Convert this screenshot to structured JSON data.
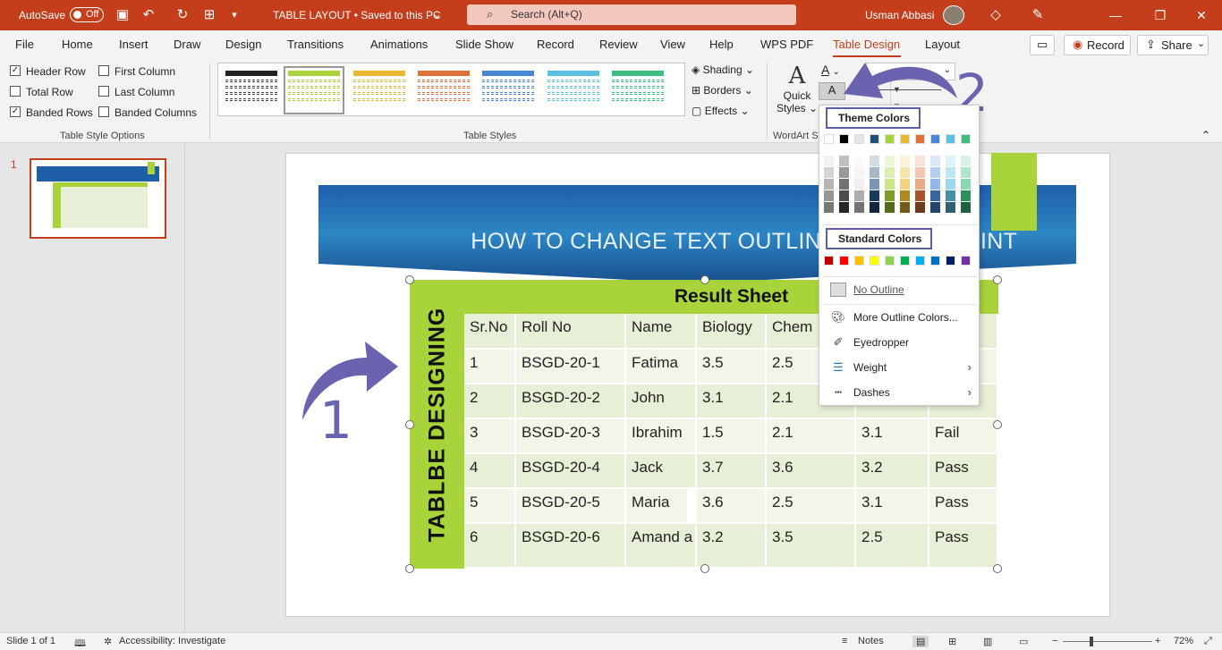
{
  "titlebar": {
    "autosave_label": "AutoSave",
    "autosave_state": "Off",
    "doc_title": "TABLE LAYOUT • Saved to this PC",
    "search_placeholder": "Search (Alt+Q)",
    "user_name": "Usman Abbasi"
  },
  "menu": {
    "tabs": [
      "File",
      "Home",
      "Insert",
      "Draw",
      "Design",
      "Transitions",
      "Animations",
      "Slide Show",
      "Record",
      "Review",
      "View",
      "Help",
      "WPS PDF",
      "Table Design",
      "Layout"
    ],
    "active_tab": "Table Design",
    "record_label": "Record",
    "share_label": "Share"
  },
  "ribbon": {
    "table_style_options": {
      "header_row": "Header Row",
      "first_column": "First Column",
      "total_row": "Total Row",
      "last_column": "Last Column",
      "banded_rows": "Banded Rows",
      "banded_columns": "Banded Columns",
      "group_label": "Table Style Options",
      "checked": {
        "header_row": true,
        "first_column": false,
        "total_row": false,
        "last_column": false,
        "banded_rows": true,
        "banded_columns": false
      }
    },
    "table_styles": {
      "group_label": "Table Styles",
      "shading": "Shading",
      "borders": "Borders",
      "effects": "Effects",
      "thumb_colors": [
        "#222222",
        "#a8d33a",
        "#e8b830",
        "#e0713a",
        "#4a86d6",
        "#5cc0e0",
        "#3cbf7e"
      ]
    },
    "wordart": {
      "quick": "Quick",
      "styles": "Styles",
      "group_label": "WordArt S"
    }
  },
  "slide_panel": {
    "slide_number": "1"
  },
  "slide": {
    "title": "HOW TO CHANGE TEXT OUTLINE COLOR",
    "title_tail": "INT",
    "side_label": "TABLBE DESIGNING",
    "table_title": "Result  Sheet",
    "headers": [
      "Sr.No",
      "Roll No",
      "Name",
      "Biology",
      "Chem",
      "",
      ""
    ],
    "rows": [
      [
        "1",
        "BSGD-20-1",
        "Fatima",
        "3.5",
        "2.5",
        "",
        ""
      ],
      [
        "2",
        "BSGD-20-2",
        "John",
        "3.1",
        "2.1",
        "",
        ""
      ],
      [
        "3",
        "BSGD-20-3",
        "Ibrahim",
        "1.5",
        "2.1",
        "3.1",
        "Fail"
      ],
      [
        "4",
        "BSGD-20-4",
        "Jack",
        "3.7",
        "3.6",
        "3.2",
        "Pass"
      ],
      [
        "5",
        "BSGD-20-5",
        "Maria",
        "3.6",
        "2.5",
        "3.1",
        "Pass"
      ],
      [
        "6",
        "BSGD-20-6",
        "Amand a",
        "3.2",
        "3.5",
        "2.5",
        "Pass"
      ]
    ]
  },
  "dropdown": {
    "theme_colors_title": "Theme Colors",
    "standard_colors_title": "Standard Colors",
    "theme_top_row": [
      "#ffffff",
      "#000000",
      "#e7e6e6",
      "#1f4e79",
      "#a8d33a",
      "#e8b830",
      "#e0713a",
      "#4a86d6",
      "#5cc0e0",
      "#3cbf7e"
    ],
    "standard_colors": [
      "#c00000",
      "#ff0000",
      "#ffc000",
      "#ffff00",
      "#92d050",
      "#00b050",
      "#00b0f0",
      "#0070c0",
      "#002060",
      "#7030a0"
    ],
    "no_outline": "No Outline",
    "more_colors": "More Outline Colors...",
    "eyedropper": "Eyedropper",
    "weight": "Weight",
    "dashes": "Dashes"
  },
  "annotations": {
    "num1": "1",
    "num2": "2"
  },
  "statusbar": {
    "slide_of": "Slide 1 of 1",
    "accessibility": "Accessibility: Investigate",
    "notes": "Notes",
    "zoom": "72%"
  }
}
